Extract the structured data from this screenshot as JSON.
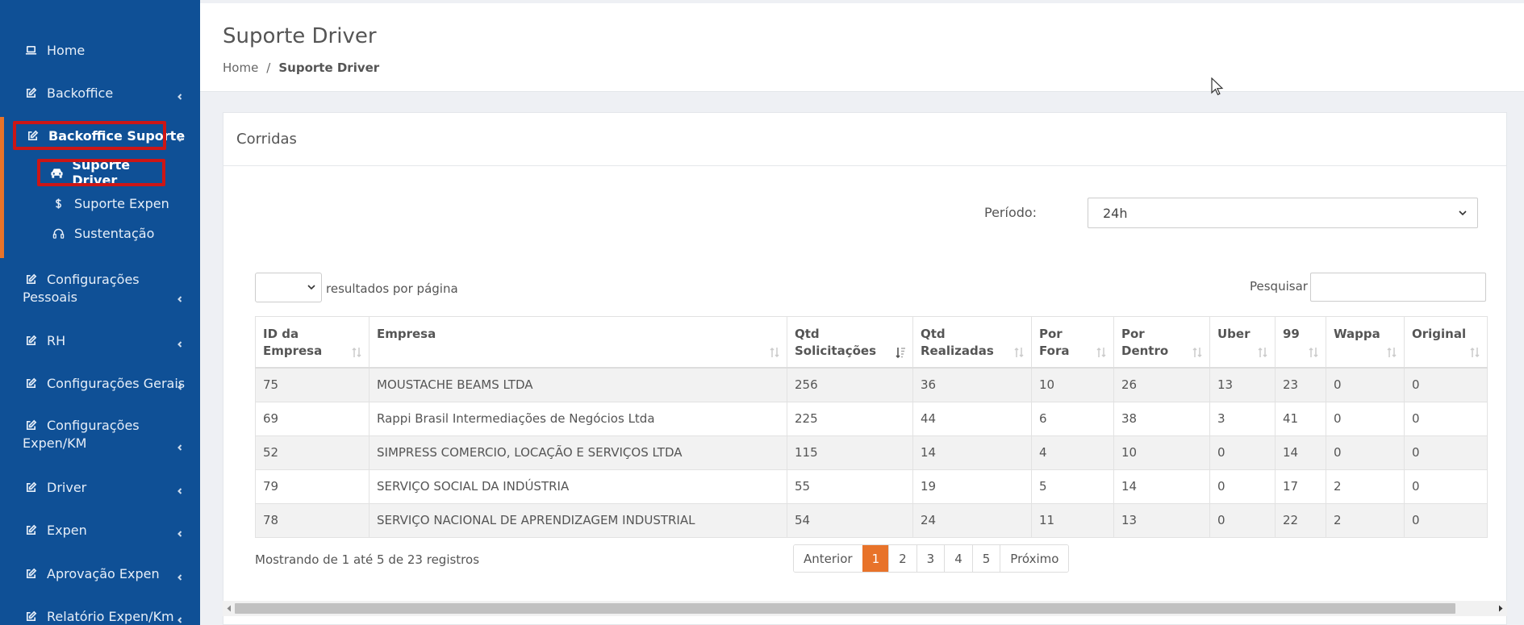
{
  "sidebar": {
    "items": [
      {
        "label": "Home",
        "icon": "laptop-icon",
        "has_chevron": false
      },
      {
        "label": "Backoffice",
        "icon": "edit-icon",
        "has_chevron": true
      },
      {
        "label": "Backoffice Suporte",
        "icon": "edit-icon",
        "has_chevron": true,
        "expanded": true
      },
      {
        "label": "Configurações Pessoais",
        "line1": "Configurações",
        "line2": "Pessoais",
        "icon": "edit-icon",
        "has_chevron": true
      },
      {
        "label": "RH",
        "icon": "edit-icon",
        "has_chevron": true
      },
      {
        "label": "Configurações Gerais",
        "icon": "edit-icon",
        "has_chevron": true
      },
      {
        "label": "Configurações Expen/KM",
        "line1": "Configurações",
        "line2": "Expen/KM",
        "icon": "edit-icon",
        "has_chevron": true
      },
      {
        "label": "Driver",
        "icon": "edit-icon",
        "has_chevron": true
      },
      {
        "label": "Expen",
        "icon": "edit-icon",
        "has_chevron": true
      },
      {
        "label": "Aprovação Expen",
        "icon": "edit-icon",
        "has_chevron": true
      },
      {
        "label": "Relatório Expen/Km",
        "icon": "edit-icon",
        "has_chevron": true
      }
    ],
    "subitems": [
      {
        "label": "Suporte Driver",
        "icon": "car-icon",
        "active": true
      },
      {
        "label": "Suporte Expen",
        "icon": "dollar-icon"
      },
      {
        "label": "Sustentação",
        "icon": "headset-icon"
      }
    ],
    "colors": {
      "background": "#0f5096",
      "accent": "#e8732a",
      "highlight_border": "#cc1616"
    }
  },
  "header": {
    "title": "Suporte Driver",
    "breadcrumb": {
      "home": "Home",
      "separator": "/",
      "current": "Suporte Driver"
    }
  },
  "card": {
    "title": "Corridas",
    "periodo": {
      "label": "Período:",
      "value": "24h"
    },
    "length_menu": {
      "value": "",
      "label": "resultados por página"
    },
    "search": {
      "label": "Pesquisar",
      "value": ""
    },
    "table": {
      "columns": [
        {
          "line1": "ID da",
          "line2": "Empresa"
        },
        {
          "line1": "Empresa",
          "line2": ""
        },
        {
          "line1": "Qtd",
          "line2": "Solicitações",
          "sorted": "desc"
        },
        {
          "line1": "Qtd",
          "line2": "Realizadas"
        },
        {
          "line1": "Por",
          "line2": "Fora"
        },
        {
          "line1": "Por",
          "line2": "Dentro"
        },
        {
          "line1": "Uber",
          "line2": ""
        },
        {
          "line1": "99",
          "line2": ""
        },
        {
          "line1": "Wappa",
          "line2": ""
        },
        {
          "line1": "Original",
          "line2": ""
        }
      ],
      "rows": [
        [
          "75",
          "MOUSTACHE BEAMS LTDA",
          "256",
          "36",
          "10",
          "26",
          "13",
          "23",
          "0",
          "0"
        ],
        [
          "69",
          "Rappi Brasil Intermediações de Negócios Ltda",
          "225",
          "44",
          "6",
          "38",
          "3",
          "41",
          "0",
          "0"
        ],
        [
          "52",
          "SIMPRESS COMERCIO, LOCAÇÃO E SERVIÇOS LTDA",
          "115",
          "14",
          "4",
          "10",
          "0",
          "14",
          "0",
          "0"
        ],
        [
          "79",
          "SERVIÇO SOCIAL DA INDÚSTRIA",
          "55",
          "19",
          "5",
          "14",
          "0",
          "17",
          "2",
          "0"
        ],
        [
          "78",
          "SERVIÇO NACIONAL DE APRENDIZAGEM INDUSTRIAL",
          "54",
          "24",
          "11",
          "13",
          "0",
          "22",
          "2",
          "0"
        ]
      ]
    },
    "info": "Mostrando de 1 até 5 de 23 registros",
    "pagination": {
      "previous": "Anterior",
      "pages": [
        "1",
        "2",
        "3",
        "4",
        "5"
      ],
      "current": "1",
      "next": "Próximo"
    }
  }
}
